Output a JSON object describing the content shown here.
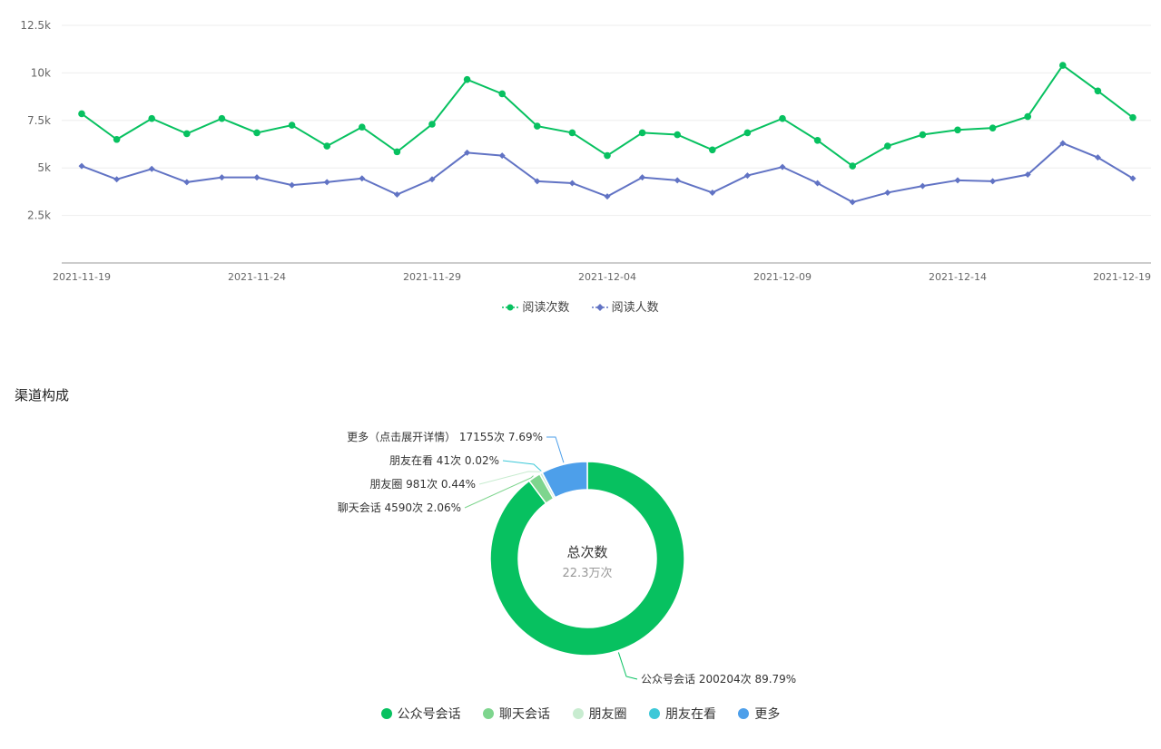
{
  "chart_data": [
    {
      "type": "line",
      "x": [
        "2021-11-19",
        "2021-11-20",
        "2021-11-21",
        "2021-11-22",
        "2021-11-23",
        "2021-11-24",
        "2021-11-25",
        "2021-11-26",
        "2021-11-27",
        "2021-11-28",
        "2021-11-29",
        "2021-11-30",
        "2021-12-01",
        "2021-12-02",
        "2021-12-03",
        "2021-12-04",
        "2021-12-05",
        "2021-12-06",
        "2021-12-07",
        "2021-12-08",
        "2021-12-09",
        "2021-12-10",
        "2021-12-11",
        "2021-12-12",
        "2021-12-13",
        "2021-12-14",
        "2021-12-15",
        "2021-12-16",
        "2021-12-17",
        "2021-12-18",
        "2021-12-19"
      ],
      "tick_labels": [
        "2021-11-19",
        "2021-11-24",
        "2021-11-29",
        "2021-12-04",
        "2021-12-09",
        "2021-12-14",
        "2021-12-19"
      ],
      "y_ticks": [
        "2.5k",
        "5k",
        "7.5k",
        "10k",
        "12.5k"
      ],
      "ylim": [
        0,
        12500
      ],
      "series": [
        {
          "name": "阅读次数",
          "color": "#07c160",
          "marker": "circle",
          "values": [
            7850,
            6500,
            7600,
            6800,
            7600,
            6850,
            7250,
            6150,
            7150,
            5850,
            7300,
            9650,
            8900,
            7200,
            6850,
            5650,
            6850,
            6750,
            5950,
            6850,
            7600,
            6450,
            5100,
            6150,
            6750,
            7000,
            7100,
            7700,
            10400,
            9050,
            7650
          ]
        },
        {
          "name": "阅读人数",
          "color": "#6173c4",
          "marker": "diamond",
          "values": [
            5100,
            4400,
            4950,
            4250,
            4500,
            4500,
            4100,
            4250,
            4450,
            3600,
            4400,
            5800,
            5650,
            4300,
            4200,
            3500,
            4500,
            4350,
            3700,
            4600,
            5050,
            4200,
            3200,
            3700,
            4050,
            4350,
            4300,
            4650,
            6300,
            5550,
            4450
          ]
        }
      ],
      "grid": true,
      "legend_position": "bottom"
    },
    {
      "type": "pie",
      "title": "渠道构成",
      "center_title": "总次数",
      "center_value": "22.3万次",
      "slices": [
        {
          "name": "公众号会话",
          "value": 200204,
          "count_label": "200204次",
          "percent_label": "89.79%",
          "color": "#07c160"
        },
        {
          "name": "聊天会话",
          "value": 4590,
          "count_label": "4590次",
          "percent_label": "2.06%",
          "color": "#7ed58e"
        },
        {
          "name": "朋友圈",
          "value": 981,
          "count_label": "981次",
          "percent_label": "0.44%",
          "color": "#c8ecd0"
        },
        {
          "name": "朋友在看",
          "value": 41,
          "count_label": "41次",
          "percent_label": "0.02%",
          "color": "#3cc8d8"
        },
        {
          "name": "更多（点击展开详情）",
          "legend_name": "更多",
          "value": 17155,
          "count_label": "17155次",
          "percent_label": "7.69%",
          "color": "#4d9fea"
        }
      ],
      "legend_position": "bottom"
    }
  ],
  "section_title": "渠道构成"
}
